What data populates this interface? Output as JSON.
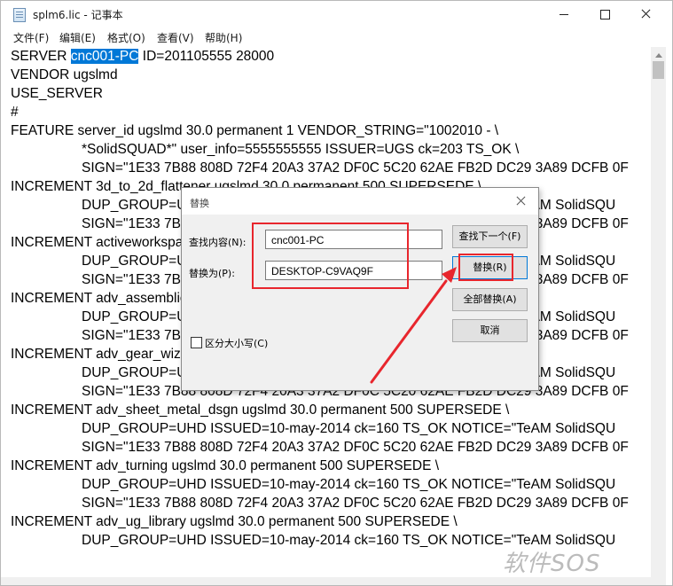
{
  "window": {
    "title": "splm6.lic - 记事本",
    "menu": [
      "文件(F)",
      "编辑(E)",
      "格式(O)",
      "查看(V)",
      "帮助(H)"
    ]
  },
  "editor": {
    "selected_text": "cnc001-PC",
    "line0_before": "SERVER ",
    "line0_after": " ID=201105555 28000",
    "lines": [
      "VENDOR ugslmd",
      "USE_SERVER",
      "#",
      "FEATURE server_id ugslmd 30.0 permanent 1 VENDOR_STRING=\"1002010 - \\",
      "*SolidSQUAD*\" user_info=5555555555 ISSUER=UGS ck=203 TS_OK \\",
      "SIGN=\"1E33 7B88 808D 72F4 20A3 37A2 DF0C 5C20 62AE FB2D DC29 3A89 DCFB 0F",
      "INCREMENT 3d_to_2d_flattener ugslmd 30.0 permanent 500 SUPERSEDE \\",
      "DUP_GROUP=UHD ISSUED=10-may-2014 ck=160 TS_OK NOTICE=\"TeAM SolidSQU",
      "SIGN=\"1E33 7B88 808D 72F4 20A3 37A2 DF0C 5C20 62AE FB2D DC29 3A89 DCFB 0F",
      "INCREMENT activeworkspace ugslmd 30.0 permanent 500 SUPERSEDE \\",
      "DUP_GROUP=UHD ISSUED=10-may-2014 ck=160 TS_OK NOTICE=\"TeAM SolidSQU",
      "SIGN=\"1E33 7B88 808D 72F4 20A3 37A2 DF0C 5C20 62AE FB2D DC29 3A89 DCFB 0F",
      "INCREMENT adv_assemblies ugslmd 30.0 permanent 500 SUPERSEDE \\",
      "DUP_GROUP=UHD ISSUED=10-may-2014 ck=160 TS_OK NOTICE=\"TeAM SolidSQU",
      "SIGN=\"1E33 7B88 808D 72F4 20A3 37A2 DF0C 5C20 62AE FB2D DC29 3A89 DCFB 0F",
      "INCREMENT adv_gear_wizard ugslmd 30.0 permanent 500 SUPERSEDE \\",
      "DUP_GROUP=UHD ISSUED=10-may-2014 ck=160 TS_OK NOTICE=\"TeAM SolidSQU",
      "SIGN=\"1E33 7B88 808D 72F4 20A3 37A2 DF0C 5C20 62AE FB2D DC29 3A89 DCFB 0F",
      "INCREMENT adv_sheet_metal_dsgn ugslmd 30.0 permanent 500 SUPERSEDE \\",
      "DUP_GROUP=UHD ISSUED=10-may-2014 ck=160 TS_OK NOTICE=\"TeAM SolidSQU",
      "SIGN=\"1E33 7B88 808D 72F4 20A3 37A2 DF0C 5C20 62AE FB2D DC29 3A89 DCFB 0F",
      "INCREMENT adv_turning ugslmd 30.0 permanent 500 SUPERSEDE \\",
      "DUP_GROUP=UHD ISSUED=10-may-2014 ck=160 TS_OK NOTICE=\"TeAM SolidSQU",
      "SIGN=\"1E33 7B88 808D 72F4 20A3 37A2 DF0C 5C20 62AE FB2D DC29 3A89 DCFB 0F",
      "INCREMENT adv_ug_library ugslmd 30.0 permanent 500 SUPERSEDE \\",
      "DUP_GROUP=UHD ISSUED=10-may-2014 ck=160 TS_OK NOTICE=\"TeAM SolidSQU"
    ]
  },
  "dialog": {
    "title": "替换",
    "find_label": "查找内容(N):",
    "find_value": "cnc001-PC",
    "replace_label": "替换为(P):",
    "replace_value": "DESKTOP-C9VAQ9F",
    "match_case_label": "区分大小写(C)",
    "match_case_checked": false,
    "buttons": {
      "find_next": "查找下一个(F)",
      "replace": "替换(R)",
      "replace_all": "全部替换(A)",
      "cancel": "取消"
    }
  },
  "annotation": {
    "color": "#e8262d"
  },
  "watermark": "软件SOS"
}
